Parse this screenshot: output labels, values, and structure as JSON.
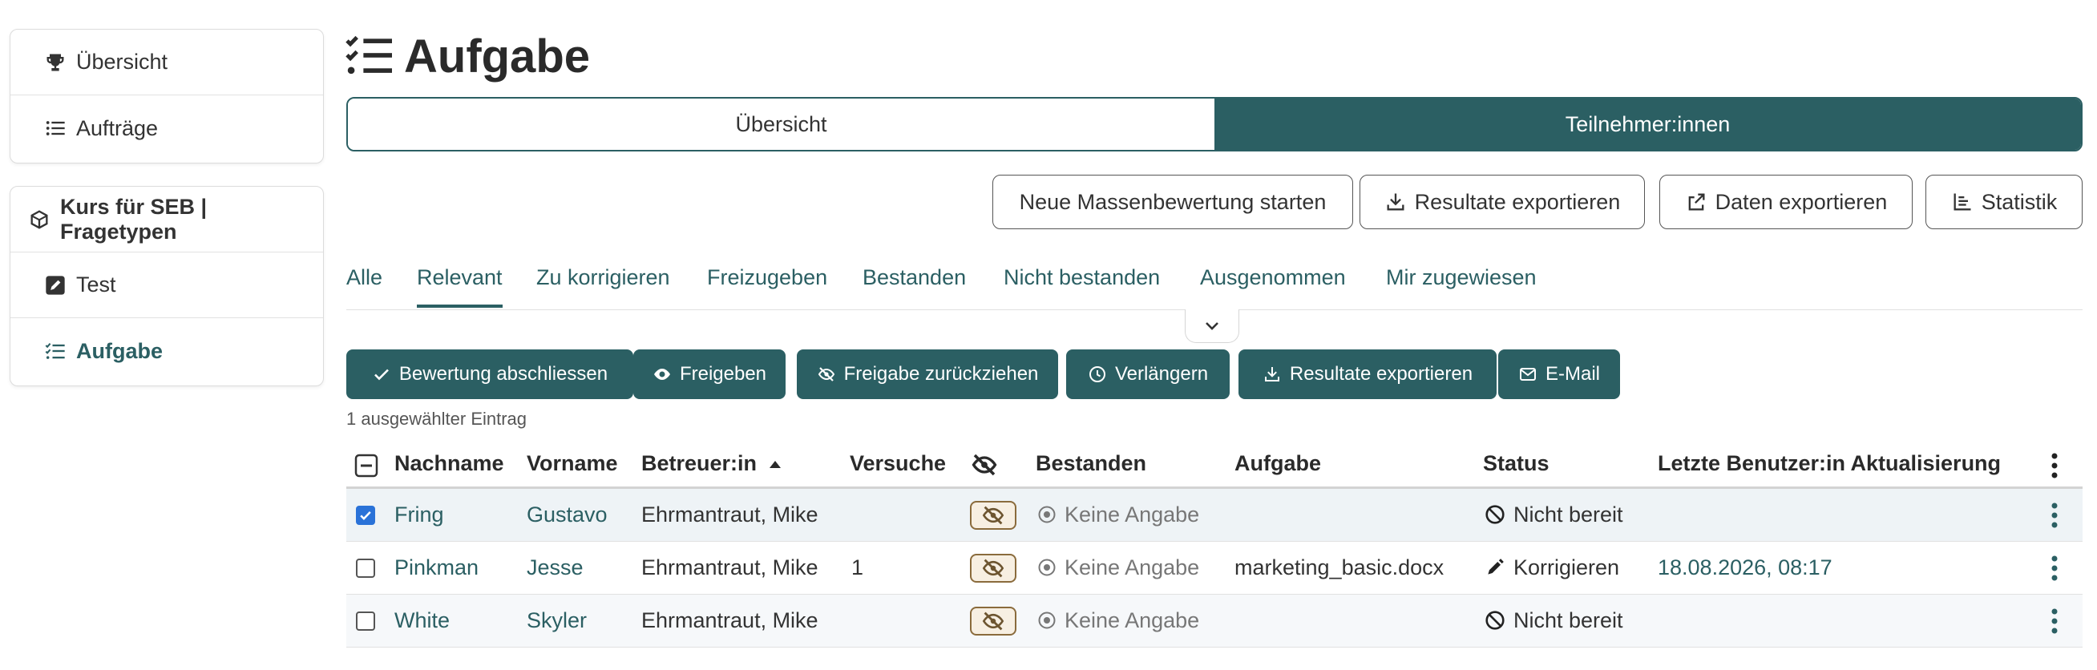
{
  "sidebar": {
    "top": [
      {
        "label": "Übersicht",
        "icon": "trophy-icon"
      },
      {
        "label": "Aufträge",
        "icon": "list-icon"
      }
    ],
    "course": {
      "label": "Kurs für SEB | Fragetypen",
      "icon": "cube-icon"
    },
    "course_items": [
      {
        "label": "Test",
        "icon": "edit-icon"
      },
      {
        "label": "Aufgabe",
        "icon": "task-list-icon",
        "active": true
      }
    ]
  },
  "page": {
    "title": "Aufgabe"
  },
  "segments": {
    "overview": "Übersicht",
    "participants": "Teilnehmer:innen",
    "active": "participants"
  },
  "toolbar": {
    "mass_grading": "Neue Massenbewertung starten",
    "export_results": "Resultate exportieren",
    "export_data": "Daten exportieren",
    "statistics": "Statistik"
  },
  "filters": {
    "active": "Relevant",
    "items": [
      "Alle",
      "Relevant",
      "Zu korrigieren",
      "Freizugeben",
      "Bestanden",
      "Nicht bestanden",
      "Ausgenommen",
      "Mir zugewiesen"
    ]
  },
  "actions": {
    "finish_grading": "Bewertung abschliessen",
    "release": "Freigeben",
    "withdraw_release": "Freigabe zurückziehen",
    "extend": "Verlängern",
    "export_results": "Resultate exportieren",
    "email": "E-Mail"
  },
  "selection_info": "1 ausgewählter Eintrag",
  "table": {
    "columns": {
      "lastname": "Nachname",
      "firstname": "Vorname",
      "coach": "Betreuer:in",
      "attempts": "Versuche",
      "passed": "Bestanden",
      "assignment": "Aufgabe",
      "status": "Status",
      "last_update": "Letzte Benutzer:in Aktualisierung"
    },
    "rows": [
      {
        "checked": true,
        "lastname": "Fring",
        "firstname": "Gustavo",
        "coach": "Ehrmantraut, Mike",
        "attempts": "",
        "passed": "Keine Angabe",
        "assignment": "",
        "status": "Nicht bereit",
        "status_icon": "ban-icon",
        "last_update": ""
      },
      {
        "checked": false,
        "lastname": "Pinkman",
        "firstname": "Jesse",
        "coach": "Ehrmantraut, Mike",
        "attempts": "1",
        "passed": "Keine Angabe",
        "assignment": "marketing_basic.docx",
        "status": "Korrigieren",
        "status_icon": "pen-icon",
        "last_update": "18.08.2026, 08:17"
      },
      {
        "checked": false,
        "lastname": "White",
        "firstname": "Skyler",
        "coach": "Ehrmantraut, Mike",
        "attempts": "",
        "passed": "Keine Angabe",
        "assignment": "",
        "status": "Nicht bereit",
        "status_icon": "ban-icon",
        "last_update": ""
      }
    ]
  },
  "colors": {
    "primary": "#2b5f63",
    "badge_border": "#8a6b3c",
    "checkbox": "#2a72d8"
  }
}
